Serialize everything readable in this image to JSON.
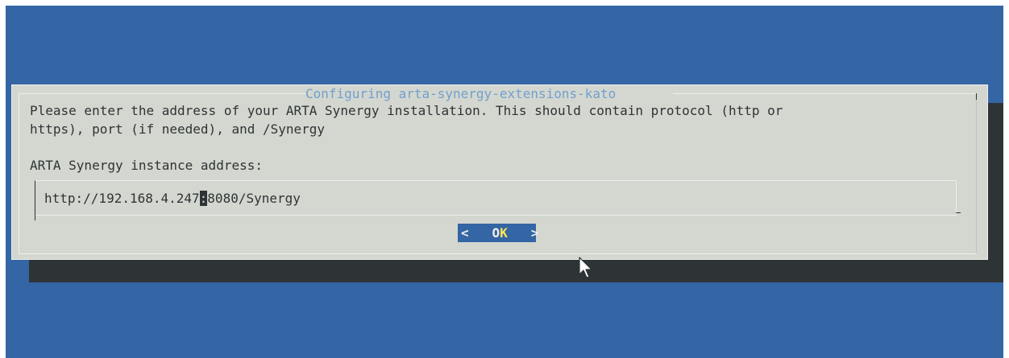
{
  "dialog": {
    "title": "Configuring arta-synergy-extensions-kato",
    "prompt": "Please enter the address of your ARTA Synergy installation. This should contain protocol (http or\nhttps), port (if needed), and /Synergy",
    "field_label": "ARTA Synergy instance address:",
    "input": {
      "value_before_cursor": "http://192.168.4.247",
      "cursor_char": ":",
      "value_after_cursor": "8080/Synergy"
    },
    "ok_button": {
      "left_bracket": "<",
      "label_first": "O",
      "label_rest": "K",
      "right_bracket": ">"
    }
  },
  "colors": {
    "background": "#3465a4",
    "dialog": "#d3d7cf",
    "shadow": "#2e3436",
    "title": "#729fcf",
    "button_bg": "#3465a4",
    "button_hotkey": "#fce94f"
  },
  "icons": {
    "pointer": "mouse-pointer-icon"
  }
}
